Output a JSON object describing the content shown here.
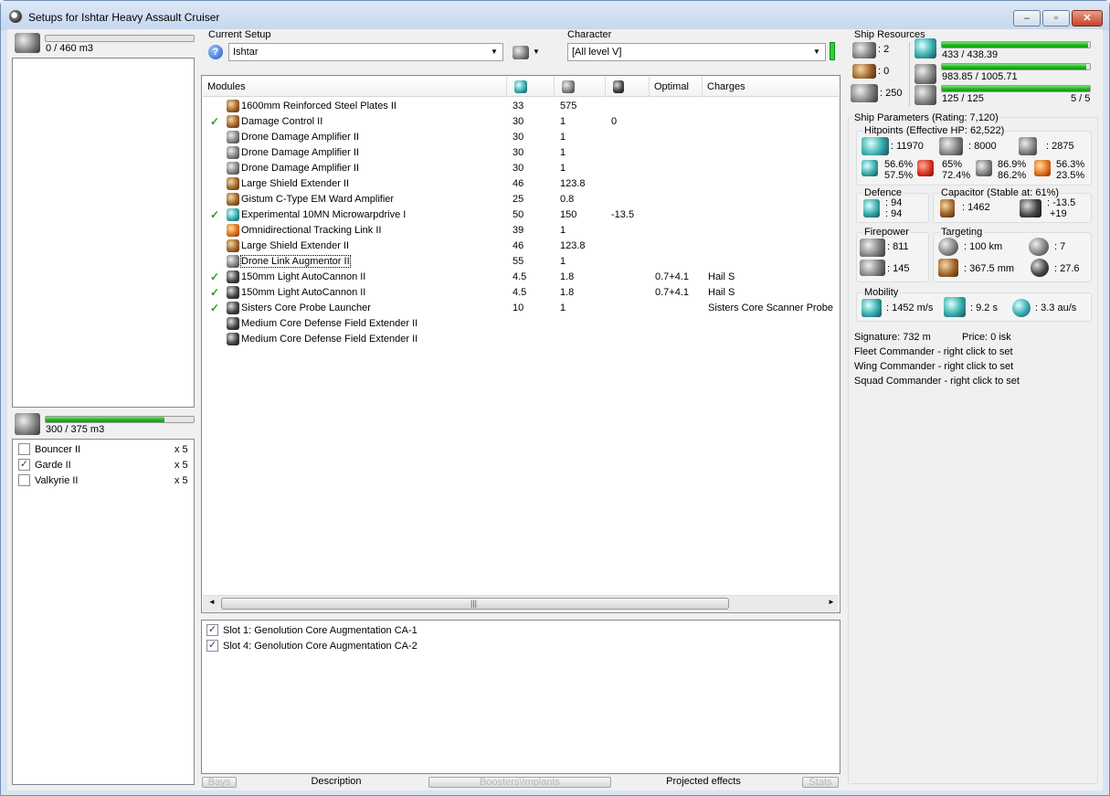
{
  "window": {
    "title": "Setups for Ishtar Heavy Assault Cruiser"
  },
  "cargo": {
    "capacity": "0 / 460 m3",
    "fill": 0.0
  },
  "drone_bay": {
    "capacity": "300 / 375 m3",
    "fill": 0.8,
    "drones": [
      {
        "name": "Bouncer II",
        "count": "x 5",
        "checked": false
      },
      {
        "name": "Garde II",
        "count": "x 5",
        "checked": true
      },
      {
        "name": "Valkyrie II",
        "count": "x 5",
        "checked": false
      }
    ]
  },
  "setup": {
    "label": "Current Setup",
    "value": "Ishtar",
    "help_icon": "question-icon"
  },
  "character": {
    "label": "Character",
    "value": "[All level V]"
  },
  "modules": {
    "headers": [
      "Modules",
      "",
      "",
      "",
      "Optimal",
      "Charges"
    ],
    "rows": [
      {
        "check": "",
        "name": "1600mm Reinforced Steel Plates II",
        "cpu": "33",
        "pg": "575",
        "cap": "",
        "optimal": "",
        "charges": "",
        "icon": "brown"
      },
      {
        "check": "✓",
        "name": "Damage Control II",
        "cpu": "30",
        "pg": "1",
        "cap": "0",
        "optimal": "",
        "charges": "",
        "icon": "brown"
      },
      {
        "check": "",
        "name": "Drone Damage Amplifier II",
        "cpu": "30",
        "pg": "1",
        "cap": "",
        "optimal": "",
        "charges": "",
        "icon": "gray"
      },
      {
        "check": "",
        "name": "Drone Damage Amplifier II",
        "cpu": "30",
        "pg": "1",
        "cap": "",
        "optimal": "",
        "charges": "",
        "icon": "gray"
      },
      {
        "check": "",
        "name": "Drone Damage Amplifier II",
        "cpu": "30",
        "pg": "1",
        "cap": "",
        "optimal": "",
        "charges": "",
        "icon": "gray"
      },
      {
        "check": "",
        "name": "Large Shield Extender II",
        "cpu": "46",
        "pg": "123.8",
        "cap": "",
        "optimal": "",
        "charges": "",
        "icon": "brown"
      },
      {
        "check": "",
        "name": "Gistum C-Type EM Ward Amplifier",
        "cpu": "25",
        "pg": "0.8",
        "cap": "",
        "optimal": "",
        "charges": "",
        "icon": "brown"
      },
      {
        "check": "✓",
        "name": "Experimental 10MN Microwarpdrive I",
        "cpu": "50",
        "pg": "150",
        "cap": "-13.5",
        "optimal": "",
        "charges": "",
        "icon": "teal"
      },
      {
        "check": "",
        "name": "Omnidirectional Tracking Link II",
        "cpu": "39",
        "pg": "1",
        "cap": "",
        "optimal": "",
        "charges": "",
        "icon": "orange"
      },
      {
        "check": "",
        "name": "Large Shield Extender II",
        "cpu": "46",
        "pg": "123.8",
        "cap": "",
        "optimal": "",
        "charges": "",
        "icon": "brown"
      },
      {
        "check": "",
        "name": "Drone Link Augmentor II",
        "cpu": "55",
        "pg": "1",
        "cap": "",
        "optimal": "",
        "charges": "",
        "icon": "gray",
        "focused": true
      },
      {
        "check": "✓",
        "name": "150mm Light AutoCannon II",
        "cpu": "4.5",
        "pg": "1.8",
        "cap": "",
        "optimal": "0.7+4.1",
        "charges": "Hail S",
        "icon": "dark"
      },
      {
        "check": "✓",
        "name": "150mm Light AutoCannon II",
        "cpu": "4.5",
        "pg": "1.8",
        "cap": "",
        "optimal": "0.7+4.1",
        "charges": "Hail S",
        "icon": "dark"
      },
      {
        "check": "✓",
        "name": "Sisters Core Probe Launcher",
        "cpu": "10",
        "pg": "1",
        "cap": "",
        "optimal": "",
        "charges": "Sisters Core Scanner Probe",
        "icon": "dark"
      },
      {
        "check": "",
        "name": "Medium Core Defense Field Extender II",
        "cpu": "",
        "pg": "",
        "cap": "",
        "optimal": "",
        "charges": "",
        "icon": "dark"
      },
      {
        "check": "",
        "name": "Medium Core Defense Field Extender II",
        "cpu": "",
        "pg": "",
        "cap": "",
        "optimal": "",
        "charges": "",
        "icon": "dark"
      }
    ]
  },
  "implants": [
    {
      "label": "Slot 1: Genolution Core Augmentation CA-1",
      "checked": true
    },
    {
      "label": "Slot 4: Genolution Core Augmentation CA-2",
      "checked": true
    }
  ],
  "tabs": {
    "bays": "Bays",
    "description": "Description",
    "boosters": "Boosters\\Implants",
    "projected": "Projected effects",
    "stats": "Stats"
  },
  "resources": {
    "title": "Ship Resources",
    "turrets": ": 2",
    "launchers": ": 0",
    "calibration": ": 250",
    "cpu": {
      "text": "433 / 438.39",
      "fill": 0.988
    },
    "powergrid": {
      "text": "983.85 / 1005.71",
      "fill": 0.978
    },
    "drone_bw": {
      "text": "125 / 125",
      "fill": 1.0
    },
    "drones_active": "5 / 5"
  },
  "params": {
    "title": "Ship Parameters (Rating: 7,120)",
    "hitpoints": {
      "title": "Hitpoints (Effective HP: 62,522)",
      "shield": ": 11970",
      "armor": ": 8000",
      "structure": ": 2875",
      "res": [
        {
          "a": "56.6%",
          "b": "57.5%"
        },
        {
          "a": "65%",
          "b": "72.4%"
        },
        {
          "a": "86.9%",
          "b": "86.2%"
        },
        {
          "a": "56.3%",
          "b": "23.5%"
        }
      ]
    },
    "defence": {
      "title": "Defence",
      "a": ": 94",
      "b": ": 94"
    },
    "capacitor": {
      "title": "Capacitor (Stable at: 61%)",
      "amount": ": 1462",
      "delta1": ": -13.5",
      "delta2": "+19"
    },
    "firepower": {
      "title": "Firepower",
      "drones": ": 811",
      "guns": ": 145"
    },
    "targeting": {
      "title": "Targeting",
      "range": ": 100 km",
      "targets": ": 7",
      "resolution": ": 367.5 mm",
      "sensor": ": 27.6"
    },
    "mobility": {
      "title": "Mobility",
      "velocity": ": 1452 m/s",
      "align": ": 9.2 s",
      "warp": ": 3.3 au/s"
    }
  },
  "misc": {
    "signature": "Signature: 732 m",
    "price": "Price: 0 isk",
    "fleet": "Fleet Commander - right click to set",
    "wing": "Wing Commander - right click to set",
    "squad": "Squad Commander - right click to set"
  }
}
